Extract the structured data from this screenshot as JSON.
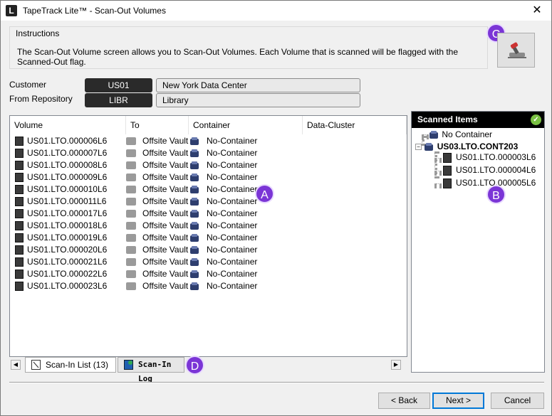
{
  "window": {
    "title": "TapeTrack Lite™ - Scan-Out Volumes",
    "app_icon_letter": "L",
    "close_glyph": "✕"
  },
  "instructions": {
    "label": "Instructions",
    "text": "The Scan-Out Volume screen allows you to Scan-Out Volumes. Each Volume that is scanned will be flagged with the Scanned-Out flag."
  },
  "badges": {
    "a": "A",
    "b": "B",
    "c": "C",
    "d": "D"
  },
  "customer": {
    "label": "Customer",
    "code": "US01",
    "name": "New York Data Center"
  },
  "repository": {
    "label": "From Repository",
    "code": "LIBR",
    "name": "Library"
  },
  "list": {
    "columns": [
      "Volume",
      "To",
      "Container",
      "Data-Cluster"
    ],
    "rows": [
      {
        "volume": "US01.LTO.000006L6",
        "to": "Offsite Vault",
        "container": "No-Container"
      },
      {
        "volume": "US01.LTO.000007L6",
        "to": "Offsite Vault",
        "container": "No-Container"
      },
      {
        "volume": "US01.LTO.000008L6",
        "to": "Offsite Vault",
        "container": "No-Container"
      },
      {
        "volume": "US01.LTO.000009L6",
        "to": "Offsite Vault",
        "container": "No-Container"
      },
      {
        "volume": "US01.LTO.000010L6",
        "to": "Offsite Vault",
        "container": "No-Container"
      },
      {
        "volume": "US01.LTO.000011L6",
        "to": "Offsite Vault",
        "container": "No-Container"
      },
      {
        "volume": "US01.LTO.000017L6",
        "to": "Offsite Vault",
        "container": "No-Container"
      },
      {
        "volume": "US01.LTO.000018L6",
        "to": "Offsite Vault",
        "container": "No-Container"
      },
      {
        "volume": "US01.LTO.000019L6",
        "to": "Offsite Vault",
        "container": "No-Container"
      },
      {
        "volume": "US01.LTO.000020L6",
        "to": "Offsite Vault",
        "container": "No-Container"
      },
      {
        "volume": "US01.LTO.000021L6",
        "to": "Offsite Vault",
        "container": "No-Container"
      },
      {
        "volume": "US01.LTO.000022L6",
        "to": "Offsite Vault",
        "container": "No-Container"
      },
      {
        "volume": "US01.LTO.000023L6",
        "to": "Offsite Vault",
        "container": "No-Container"
      }
    ]
  },
  "tabs": [
    {
      "label": "Scan-In List (13)",
      "active": true,
      "icon": "list-icon"
    },
    {
      "label": "Scan-In Log",
      "active": false,
      "icon": "log-icon"
    }
  ],
  "scanned": {
    "header": "Scanned Items",
    "tree": {
      "no_container": "No Container",
      "container": "US03.LTO.CONT203",
      "children": [
        "US01.LTO.000003L6",
        "US01.LTO.000004L6",
        "US01.LTO.000005L6"
      ]
    }
  },
  "buttons": {
    "back": "< Back",
    "next": "Next >",
    "cancel": "Cancel"
  },
  "icons": {
    "volume": "tape-cartridge-icon",
    "destination": "vault-truck-icon",
    "container": "container-box-icon",
    "scanner": "barcode-scanner-icon",
    "status": "check-icon"
  },
  "colors": {
    "badge": "#7b35d6",
    "scanned_header": "#000000",
    "check": "#7ac143"
  }
}
